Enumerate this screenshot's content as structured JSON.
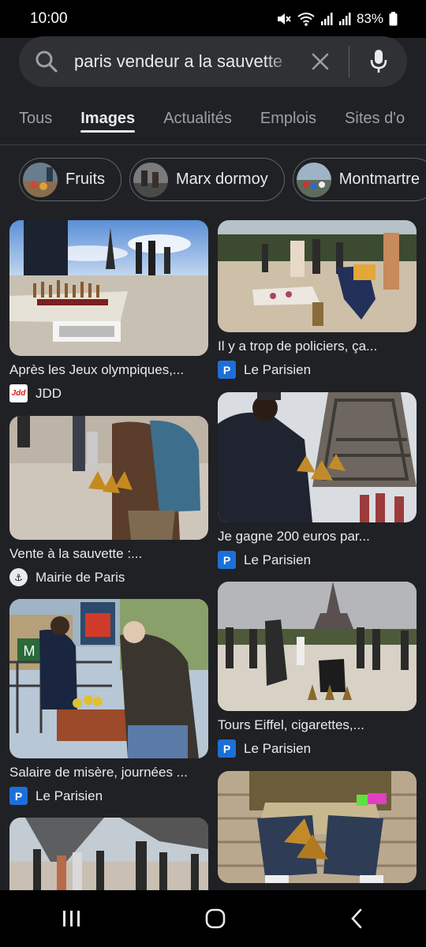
{
  "status": {
    "time": "10:00",
    "battery": "83%"
  },
  "search": {
    "query": "paris vendeur a la sauvette"
  },
  "tabs": [
    "Tous",
    "Images",
    "Actualités",
    "Emplois",
    "Sites d'o"
  ],
  "chips": [
    {
      "label": "Fruits"
    },
    {
      "label": "Marx dormoy"
    },
    {
      "label": "Montmartre"
    }
  ],
  "results": [
    {
      "title": "Après les Jeux olympiques,...",
      "source": "JDD",
      "logo": "jdd"
    },
    {
      "title": "Il y a trop de policiers, ça...",
      "source": "Le Parisien",
      "logo": "lp"
    },
    {
      "title": "Vente à la sauvette :...",
      "source": "Mairie de Paris",
      "logo": "mairie"
    },
    {
      "title": "Je gagne 200 euros par...",
      "source": "Le Parisien",
      "logo": "lp"
    },
    {
      "title": "Salaire de misère, journées ...",
      "source": "Le Parisien",
      "logo": "lp"
    },
    {
      "title": "Tours Eiffel, cigarettes,...",
      "source": "Le Parisien",
      "logo": "lp"
    }
  ],
  "colors": {
    "background": "#202124",
    "search_bg": "#303134",
    "le_parisien": "#1c6fd8"
  }
}
